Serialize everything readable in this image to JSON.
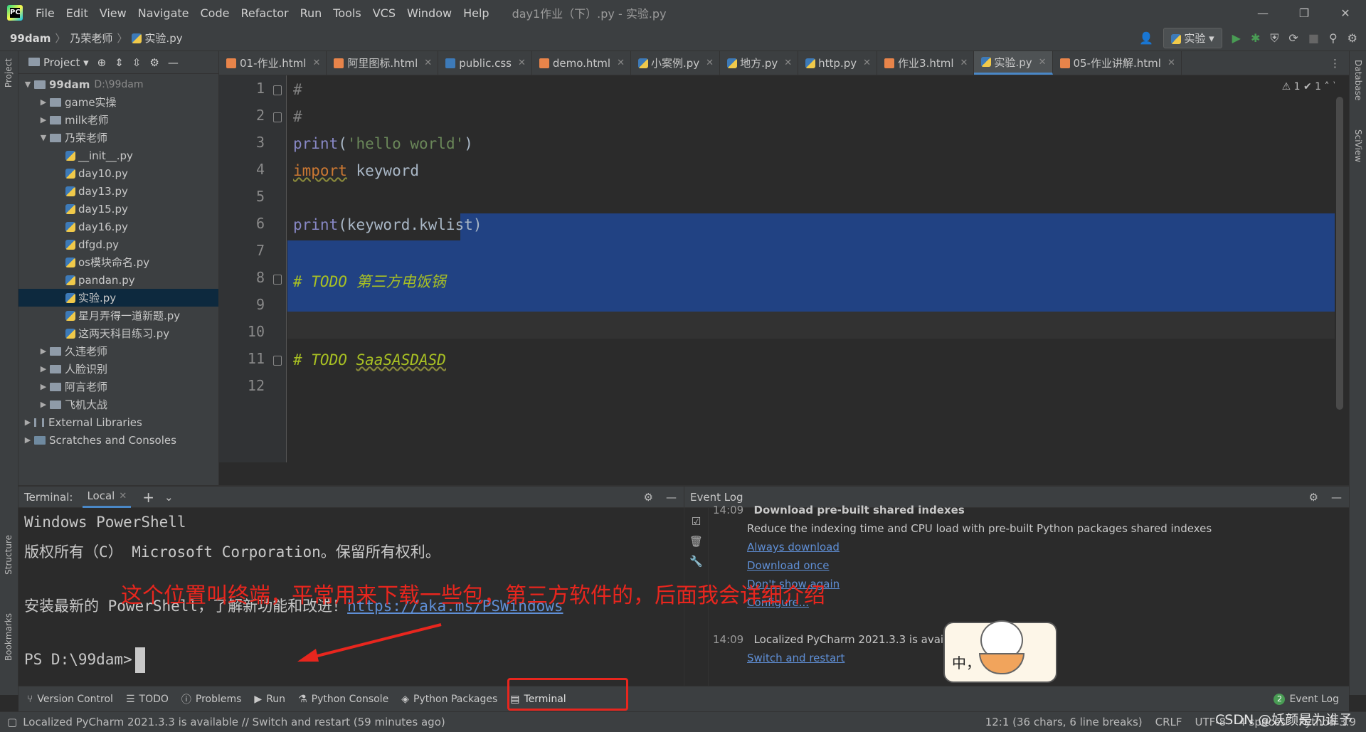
{
  "menu": {
    "items": [
      "File",
      "Edit",
      "View",
      "Navigate",
      "Code",
      "Refactor",
      "Run",
      "Tools",
      "VCS",
      "Window",
      "Help"
    ],
    "window_title": "day1作业（下）.py - 实验.py",
    "logo_text": "PC"
  },
  "window_controls": {
    "minimize": "—",
    "restore": "❐",
    "close": "✕"
  },
  "breadcrumb": {
    "root": "99dam",
    "folder": "乃荣老师",
    "file": "实验.py"
  },
  "toolbar": {
    "user_icon": "👤",
    "run_config": "实验",
    "run_icon": "▶",
    "debug_icon": "✱",
    "coverage_icon": "⛨",
    "profile_icon": "⟳",
    "stop_icon": "■",
    "search_icon": "⚲",
    "settings_icon": "⚙"
  },
  "left_strip": {
    "project": "Project",
    "structure": "Structure",
    "bookmarks": "Bookmarks"
  },
  "right_strip": {
    "database": "Database",
    "sciview": "SciView"
  },
  "project_panel": {
    "title": "Project",
    "root": {
      "name": "99dam",
      "path": "D:\\99dam"
    },
    "items": [
      {
        "name": "game实操",
        "depth": 1,
        "type": "folder",
        "expanded": false
      },
      {
        "name": "milk老师",
        "depth": 1,
        "type": "folder",
        "expanded": false
      },
      {
        "name": "乃荣老师",
        "depth": 1,
        "type": "folder",
        "expanded": true
      },
      {
        "name": "__init__.py",
        "depth": 2,
        "type": "py"
      },
      {
        "name": "day10.py",
        "depth": 2,
        "type": "py"
      },
      {
        "name": "day13.py",
        "depth": 2,
        "type": "py"
      },
      {
        "name": "day15.py",
        "depth": 2,
        "type": "py"
      },
      {
        "name": "day16.py",
        "depth": 2,
        "type": "py"
      },
      {
        "name": "dfgd.py",
        "depth": 2,
        "type": "py"
      },
      {
        "name": "os模块命名.py",
        "depth": 2,
        "type": "py"
      },
      {
        "name": "pandan.py",
        "depth": 2,
        "type": "py"
      },
      {
        "name": "实验.py",
        "depth": 2,
        "type": "py",
        "selected": true
      },
      {
        "name": "星月弄得一道新题.py",
        "depth": 2,
        "type": "py"
      },
      {
        "name": "这两天科目练习.py",
        "depth": 2,
        "type": "py"
      },
      {
        "name": "久违老师",
        "depth": 1,
        "type": "folder",
        "expanded": false
      },
      {
        "name": "人脸识别",
        "depth": 1,
        "type": "folder",
        "expanded": false
      },
      {
        "name": "阿言老师",
        "depth": 1,
        "type": "folder",
        "expanded": false
      },
      {
        "name": "飞机大战",
        "depth": 1,
        "type": "folder",
        "expanded": false
      },
      {
        "name": "External Libraries",
        "depth": 0,
        "type": "lib",
        "expanded": false
      },
      {
        "name": "Scratches and Consoles",
        "depth": 0,
        "type": "scratch",
        "expanded": false
      }
    ]
  },
  "tabs": [
    {
      "label": "01-作业.html",
      "type": "html"
    },
    {
      "label": "阿里图标.html",
      "type": "html"
    },
    {
      "label": "public.css",
      "type": "css"
    },
    {
      "label": "demo.html",
      "type": "html"
    },
    {
      "label": "小案例.py",
      "type": "py"
    },
    {
      "label": "地方.py",
      "type": "py"
    },
    {
      "label": "http.py",
      "type": "py"
    },
    {
      "label": "作业3.html",
      "type": "html"
    },
    {
      "label": "实验.py",
      "type": "py",
      "active": true
    },
    {
      "label": "05-作业讲解.html",
      "type": "html"
    }
  ],
  "editor": {
    "line_numbers": [
      "1",
      "2",
      "3",
      "4",
      "5",
      "6",
      "7",
      "8",
      "9",
      "10",
      "11",
      "12"
    ],
    "inspections": "⚠ 1   ✔ 1   ˄   ˅",
    "code": {
      "l1": "#",
      "l2": "#",
      "l3_fn": "print",
      "l3_open": "(",
      "l3_str": "'hello world'",
      "l3_close": ")",
      "l4_kw": "import",
      "l4_rest": " keyword",
      "l6_fn": "print",
      "l6_rest": "(keyword.kwlist)",
      "l8": "# TODO 第三方电饭锅",
      "l11_pre": "# TODO ",
      "l11_word": "SaaSASDASD"
    }
  },
  "terminal": {
    "title": "Terminal:",
    "tab": "Local",
    "add": "+",
    "chevron": "⌄",
    "gear": "⚙",
    "minimize": "—",
    "lines": {
      "l1": "Windows PowerShell",
      "l2": "版权所有（C） Microsoft Corporation。保留所有权利。",
      "l3_pre": "安装最新的 PowerShell，了解新功能和改进！",
      "l3_link": "https://aka.ms/PSWindows",
      "prompt": "PS D:\\99dam>"
    }
  },
  "event_log": {
    "title": "Event Log",
    "gear": "⚙",
    "minimize": "—",
    "tools": [
      "☑",
      "🗑",
      "🔧"
    ],
    "e1": {
      "time": "14:09",
      "title": "Download pre-built shared indexes",
      "desc": "Reduce the indexing time and CPU load with pre-built Python packages shared indexes",
      "links": [
        "Always download",
        "Download once",
        "Don't show again",
        "Configure..."
      ]
    },
    "e2": {
      "time": "14:09",
      "title": "Localized PyCharm 2021.3.3 is available",
      "link": "Switch and restart"
    }
  },
  "tool_windows": {
    "items": [
      {
        "icon": "⑂",
        "label": "Version Control"
      },
      {
        "icon": "☰",
        "label": "TODO"
      },
      {
        "icon": "ⓘ",
        "label": "Problems"
      },
      {
        "icon": "▶",
        "label": "Run"
      },
      {
        "icon": "⚗",
        "label": "Python Console"
      },
      {
        "icon": "◈",
        "label": "Python Packages"
      },
      {
        "icon": "▤",
        "label": "Terminal",
        "active": true
      }
    ],
    "event_log": "Event Log",
    "event_badge": "2"
  },
  "status_bar": {
    "message": "Localized PyCharm 2021.3.3 is available // Switch and restart (59 minutes ago)",
    "position": "12:1 (36 chars, 6 line breaks)",
    "line_sep": "CRLF",
    "encoding": "UTF-8",
    "indent": "4 spaces",
    "interpreter": "Python 3.9"
  },
  "annotation": {
    "text": "这个位置叫终端，平常用来下载一些包，第三方软件的，后面我会详细介绍"
  },
  "sticker": {
    "text": "中，"
  },
  "watermark": {
    "text": "CSDN @妖颜是为谁予"
  },
  "colors": {
    "accent": "#4a88c7",
    "selection": "#214283",
    "annotation_red": "#e8261e"
  }
}
